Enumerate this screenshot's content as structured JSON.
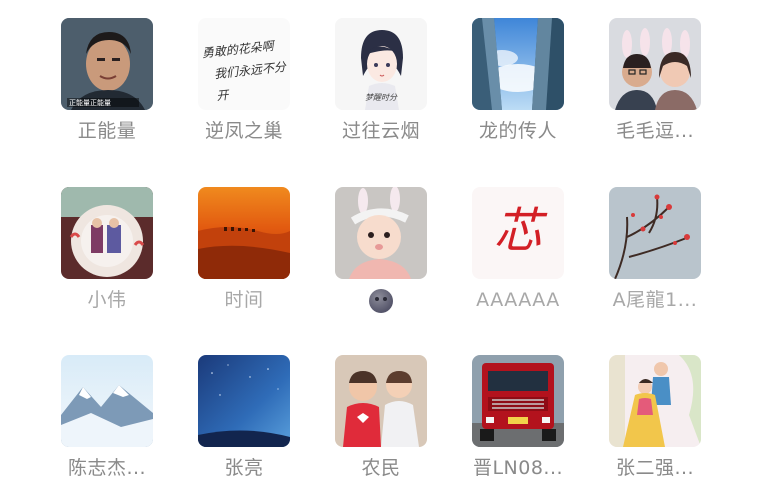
{
  "contacts": [
    {
      "name": "正能量",
      "avatar": "man-portrait-photo"
    },
    {
      "name": "逆凤之巢",
      "avatar": "calligraphy-text-image"
    },
    {
      "name": "过往云烟",
      "avatar": "anime-girl-sketch"
    },
    {
      "name": "龙的传人",
      "avatar": "skyscrapers-sky-photo"
    },
    {
      "name": "毛毛逗...",
      "avatar": "couple-bunny-ears-photo"
    },
    {
      "name": "小伟",
      "avatar": "cake-decoration-photo"
    },
    {
      "name": "时间",
      "avatar": "desert-camels-sunset"
    },
    {
      "name": "",
      "avatar": "baby-bunny-ears-photo",
      "name_icon": "emoji-face-icon"
    },
    {
      "name": "AAAAAA",
      "avatar": "red-calligraphy-logo"
    },
    {
      "name": "A尾龍1...",
      "avatar": "plum-blossom-branch"
    },
    {
      "name": "陈志杰...",
      "avatar": "snow-mountains-photo"
    },
    {
      "name": "张亮",
      "avatar": "blue-night-sky"
    },
    {
      "name": "农民",
      "avatar": "two-children-photo"
    },
    {
      "name": "晋LN08...",
      "avatar": "red-truck-photo"
    },
    {
      "name": "张二强...",
      "avatar": "couple-wedding-photo"
    }
  ],
  "avatar_text": {
    "calligraphy_line1": "勇敢的花朵啊",
    "calligraphy_line2": "我们永远不分开",
    "anime_caption": "梦醒时分",
    "man_caption": "正能量正能量",
    "logo_glyph": "芯"
  }
}
